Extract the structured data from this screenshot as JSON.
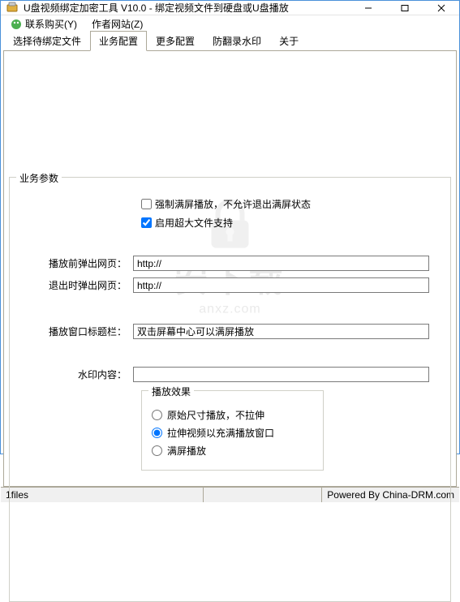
{
  "window": {
    "title": "U盘视频绑定加密工具 V10.0 - 绑定视频文件到硬盘或U盘播放"
  },
  "menu": {
    "contact": "联系购买(Y)",
    "website": "作者网站(Z)"
  },
  "tabs": {
    "t0": "选择待绑定文件",
    "t1": "业务配置",
    "t2": "更多配置",
    "t3": "防翻录水印",
    "t4": "关于"
  },
  "group": {
    "title": "业务参数"
  },
  "checks": {
    "force_fullscreen": "强制满屏播放，不允许退出满屏状态",
    "large_file": "启用超大文件支持"
  },
  "labels": {
    "pre_url": "播放前弹出网页：",
    "exit_url": "退出时弹出网页：",
    "win_title": "播放窗口标题栏：",
    "watermark": "水印内容："
  },
  "values": {
    "pre_url": "http://",
    "exit_url": "http://",
    "win_title": "双击屏幕中心可以满屏播放",
    "watermark": ""
  },
  "effect": {
    "title": "播放效果",
    "opt0": "原始尺寸播放，不拉伸",
    "opt1": "拉伸视频以充满播放窗口",
    "opt2": "满屏播放"
  },
  "status": {
    "left": "1files",
    "right": "Powered By China-DRM.com"
  },
  "wm": {
    "main": "安下载",
    "sub": "anxz.com"
  }
}
